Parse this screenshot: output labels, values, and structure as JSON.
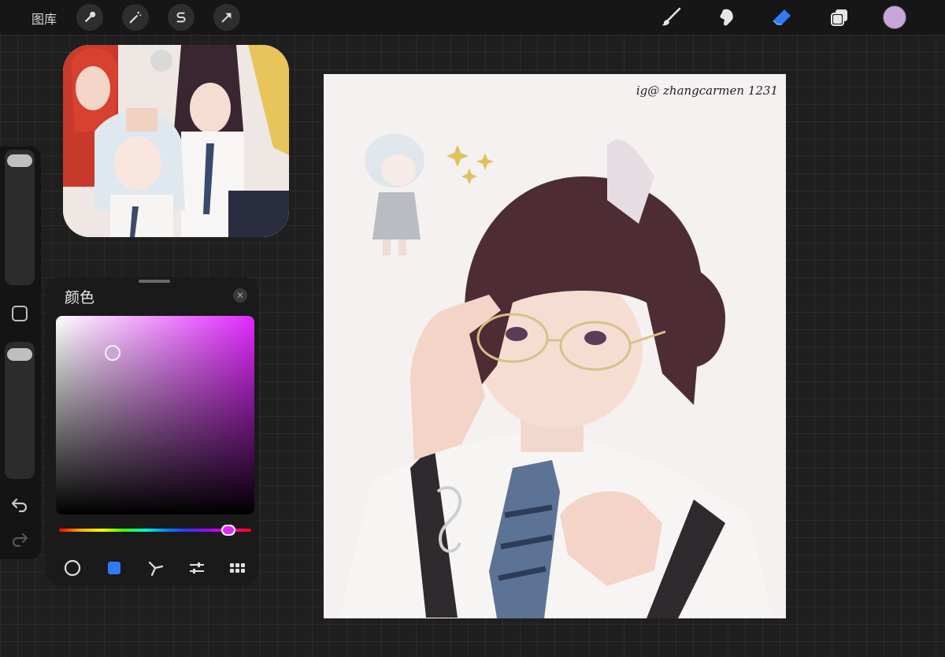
{
  "toolbar": {
    "gallery_label": "图库",
    "left_tools": [
      "wrench-icon",
      "magic-wand-icon",
      "selection-s-icon",
      "transform-arrow-icon"
    ],
    "right_tools": [
      "brush-icon",
      "smudge-icon",
      "eraser-icon",
      "layers-icon"
    ],
    "active_tool": "eraser-icon",
    "current_color": "#c9a6d9"
  },
  "sidebar": {
    "brush_size_level": 1.0,
    "opacity_level": 1.0
  },
  "color_panel": {
    "title": "颜色",
    "selected_color": "#c9a6d9",
    "hue_color": "#e129ff",
    "hue_position": 0.88,
    "modes": [
      "disc-mode-icon",
      "classic-mode-icon",
      "harmony-mode-icon",
      "value-mode-icon",
      "palettes-mode-icon"
    ],
    "active_mode": "classic-mode-icon",
    "accent": "#2f7bf5"
  },
  "canvas": {
    "signature": "ig@ zhangcarmen 1231"
  }
}
